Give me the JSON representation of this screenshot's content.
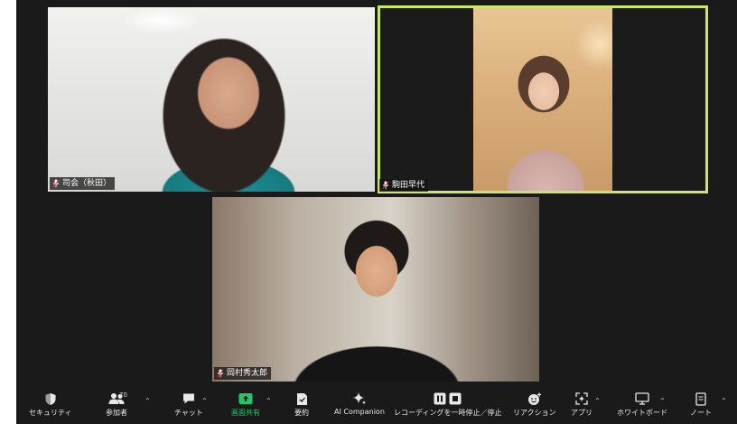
{
  "participants": [
    {
      "name": "司会（秋田）",
      "active": false
    },
    {
      "name": "駒田早代",
      "active": true
    },
    {
      "name": "岡村秀太郎",
      "active": false
    }
  ],
  "toolbar": {
    "security": {
      "label": "セキュリティ",
      "icon": "shield-icon"
    },
    "participants": {
      "label": "参加者",
      "count": "70",
      "icon": "people-icon"
    },
    "chat": {
      "label": "チャット",
      "icon": "chat-icon"
    },
    "share": {
      "label": "画面共有",
      "icon": "share-screen-icon",
      "color": "#25c26a"
    },
    "summary": {
      "label": "要約",
      "icon": "summary-icon"
    },
    "ai": {
      "label": "AI Companion",
      "icon": "sparkle-icon"
    },
    "record": {
      "label": "レコーディングを一時停止／停止",
      "icon": "pause-stop-icon"
    },
    "reactions": {
      "label": "リアクション",
      "icon": "reaction-icon"
    },
    "apps": {
      "label": "アプリ",
      "icon": "apps-icon"
    },
    "whiteboard": {
      "label": "ホワイトボード",
      "icon": "whiteboard-icon"
    },
    "notes": {
      "label": "ノート",
      "icon": "notes-icon"
    }
  },
  "colors": {
    "active_border": "#c9e56a",
    "background": "#1a1a1a",
    "share_green": "#25c26a"
  }
}
